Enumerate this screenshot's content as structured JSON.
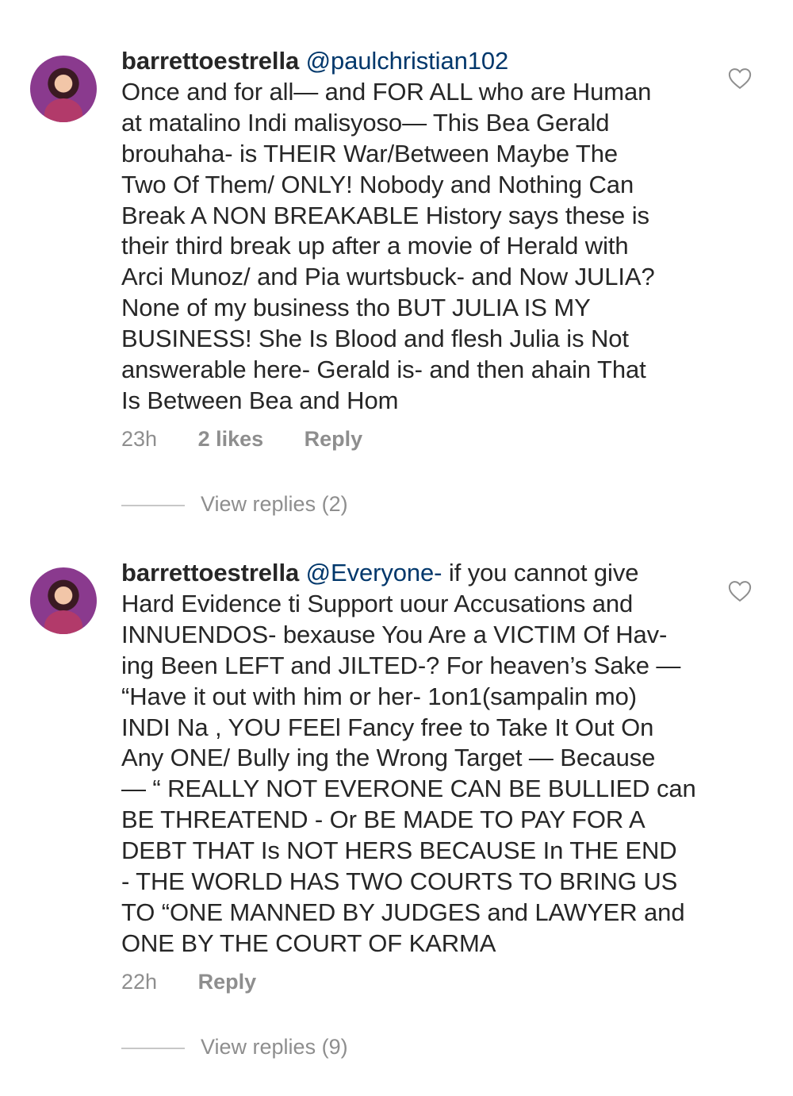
{
  "comments": [
    {
      "username": "barrettoestrella",
      "mention": "@paulchristian102",
      "lines": [
        "Once and for all— and FOR ALL who are Human",
        "at matalino Indi malisyoso— This Bea Gerald",
        "brouhaha- is THEIR  War/Between Maybe The",
        "Two Of Them/ ONLY!  Nobody and Nothing Can",
        "Break A NON BREAKABLE  History says these is",
        "their third break up after a movie of Herald with",
        "Arci Munoz/ and Pia wurtsbuck- and Now JULIA?",
        "None of my business tho BUT JULIA IS MY",
        "BUSINESS! She Is Blood and flesh  Julia is Not",
        "answerable here- Gerald is- and then ahain That",
        "Is Between Bea and Hom"
      ],
      "time": "23h",
      "likes": "2 likes",
      "reply_label": "Reply",
      "view_replies": "View replies (2)"
    },
    {
      "username": "barrettoestrella",
      "mention": "@Everyone-",
      "first_line_rest": " if you cannot give",
      "lines": [
        "Hard Evidence ti Support uour Accusations and",
        "INNUENDOS- bexause You Are a VICTIM Of Hav-",
        "ing Been LEFT and JILTED-? For heaven’s Sake —",
        "“Have it out with him or her- 1on1(sampalin mo)",
        "INDI Na , YOU FEEl Fancy free  to Take It Out On",
        "Any ONE/ Bully ing the Wrong Target — Because",
        "— “ REALLY NOT EVERONE CAN BE BULLIED can",
        "BE THREATEND - Or BE MADE TO PAY FOR A",
        "DEBT THAT Is NOT HERS  BECAUSE In THE END",
        "- THE WORLD HAS TWO COURTS TO BRING US",
        "TO “ONE MANNED BY JUDGES and LAWYER and",
        "ONE BY THE COURT OF KARMA"
      ],
      "time": "22h",
      "reply_label": "Reply",
      "view_replies": "View replies (9)"
    }
  ],
  "icons": {
    "like": "heart-outline-icon",
    "avatar": "profile-avatar"
  },
  "colors": {
    "text": "#262626",
    "mention": "#00376b",
    "meta": "#8e8e8e"
  }
}
